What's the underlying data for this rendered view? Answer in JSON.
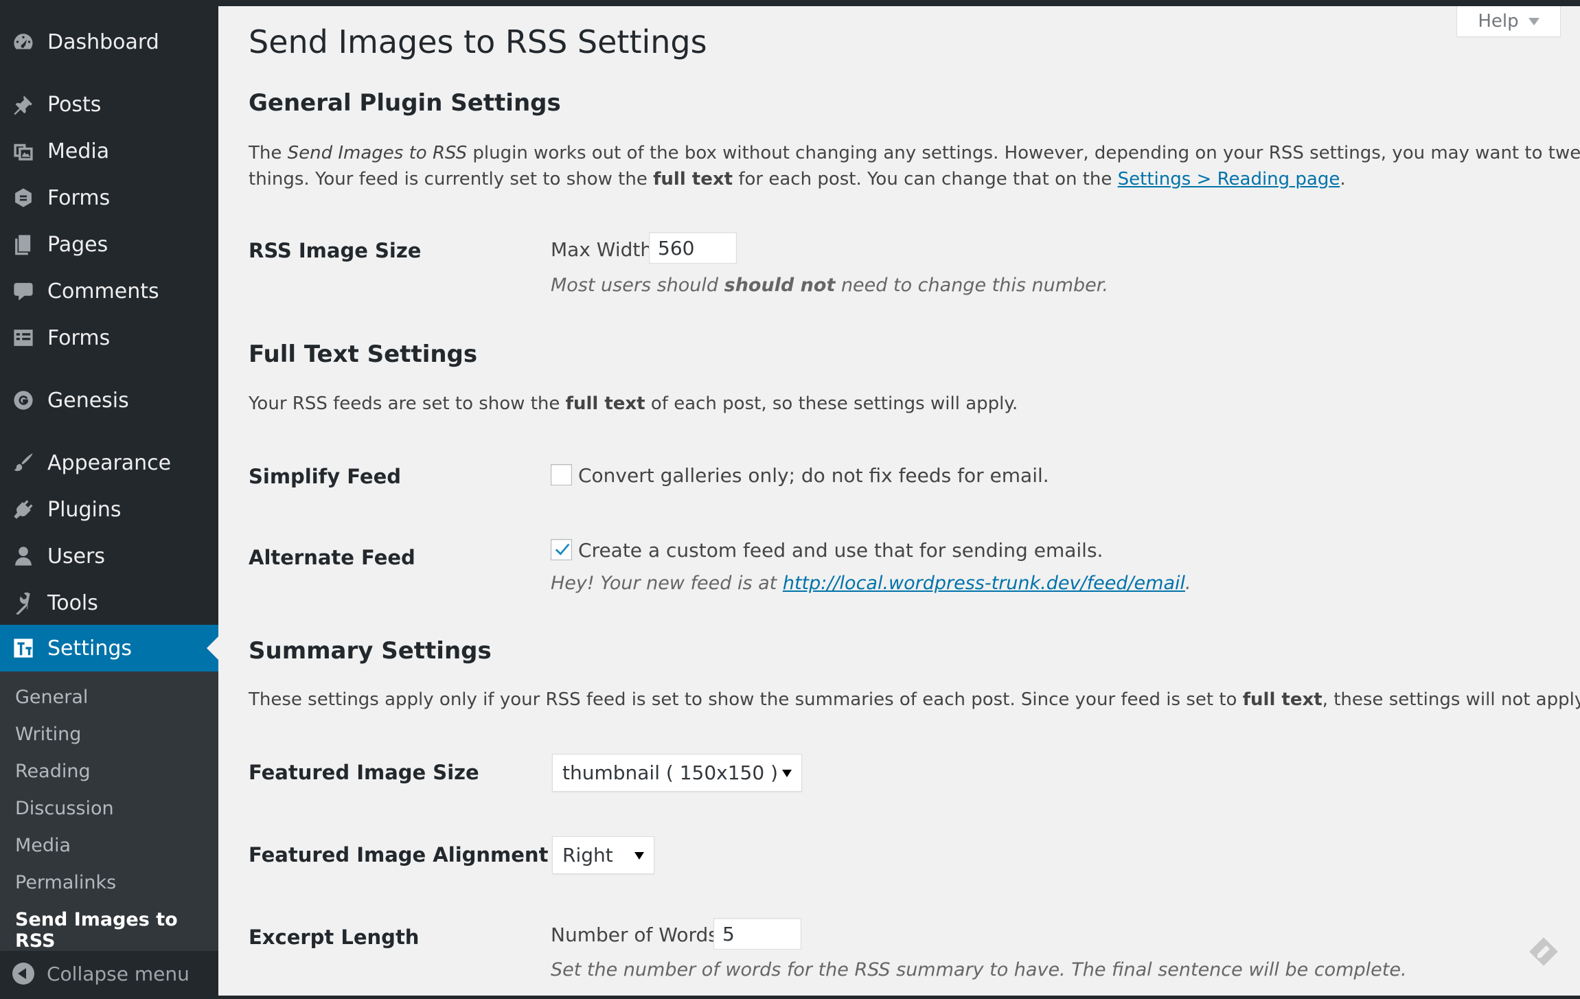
{
  "sidebar": {
    "menu": [
      {
        "label": "Dashboard",
        "icon": "dashboard-icon"
      },
      {
        "label": "Posts",
        "icon": "pin-icon"
      },
      {
        "label": "Media",
        "icon": "media-icon"
      },
      {
        "label": "Forms",
        "icon": "forms-icon"
      },
      {
        "label": "Pages",
        "icon": "pages-icon"
      },
      {
        "label": "Comments",
        "icon": "comments-icon"
      },
      {
        "label": "Forms",
        "icon": "forms-list-icon"
      },
      {
        "label": "Genesis",
        "icon": "genesis-icon"
      },
      {
        "label": "Appearance",
        "icon": "appearance-icon"
      },
      {
        "label": "Plugins",
        "icon": "plugins-icon"
      },
      {
        "label": "Users",
        "icon": "users-icon"
      },
      {
        "label": "Tools",
        "icon": "tools-icon"
      },
      {
        "label": "Settings",
        "icon": "settings-icon"
      }
    ],
    "submenu": [
      "General",
      "Writing",
      "Reading",
      "Discussion",
      "Media",
      "Permalinks",
      "Send Images to RSS"
    ],
    "active_submenu": "Send Images to RSS",
    "collapse_label": "Collapse menu"
  },
  "help": {
    "label": "Help"
  },
  "page": {
    "title": "Send Images to RSS Settings",
    "general": {
      "heading": "General Plugin Settings",
      "intro_1": "The ",
      "intro_plugin": "Send Images to RSS",
      "intro_2": " plugin works out of the box without changing any settings. However, depending on your RSS settings, you may want to tweak some",
      "intro_3": "things. Your feed is currently set to show the ",
      "intro_fulltext": "full text",
      "intro_4": " for each post. You can change that on the ",
      "intro_link": "Settings > Reading page",
      "intro_5": ".",
      "image_size_label": "RSS Image Size",
      "max_width_label": "Max Width",
      "max_width_value": "560",
      "desc_1": "Most users should ",
      "desc_bold": "should not",
      "desc_2": " need to change this number."
    },
    "fulltext": {
      "heading": "Full Text Settings",
      "intro_1": "Your RSS feeds are set to show the ",
      "intro_bold": "full text",
      "intro_2": " of each post, so these settings will apply.",
      "simplify_label": "Simplify Feed",
      "simplify_text": "Convert galleries only; do not fix feeds for email.",
      "simplify_checked": false,
      "alternate_label": "Alternate Feed",
      "alternate_text": "Create a custom feed and use that for sending emails.",
      "alternate_checked": true,
      "feed_note": "Hey! Your new feed is at ",
      "feed_url": "http://local.wordpress-trunk.dev/feed/email",
      "feed_note_end": "."
    },
    "summary": {
      "heading": "Summary Settings",
      "intro_1": "These settings apply only if your RSS feed is set to show the summaries of each post. Since your feed is set to ",
      "intro_bold": "full text",
      "intro_2": ", these settings will not apply.",
      "featured_size_label": "Featured Image Size",
      "featured_size_value": "thumbnail ( 150x150 )",
      "alignment_label": "Featured Image Alignment",
      "alignment_value": "Right",
      "excerpt_label": "Excerpt Length",
      "words_label": "Number of Words",
      "words_value": "5",
      "excerpt_desc": "Set the number of words for the RSS summary to have. The final sentence will be complete."
    }
  },
  "colors": {
    "admin_bar": "#23282d",
    "menu_bg": "#23282d",
    "submenu_bg": "#32373c",
    "accent": "#0073aa",
    "content_bg": "#f1f1f1"
  }
}
